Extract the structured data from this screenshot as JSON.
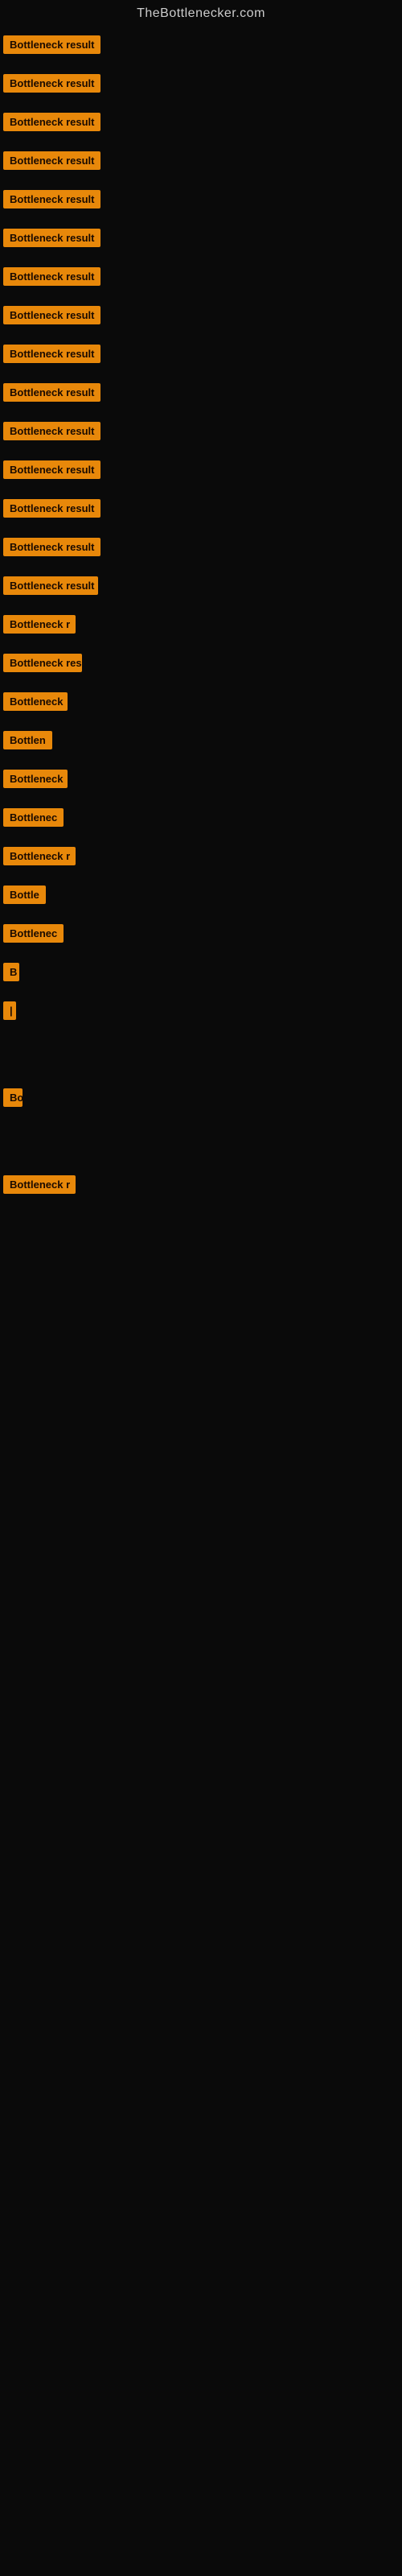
{
  "site": {
    "title": "TheBottlenecker.com"
  },
  "items": [
    {
      "label": "Bottleneck result",
      "width": 130
    },
    {
      "label": "Bottleneck result",
      "width": 135
    },
    {
      "label": "Bottleneck result",
      "width": 130
    },
    {
      "label": "Bottleneck result",
      "width": 130
    },
    {
      "label": "Bottleneck result",
      "width": 133
    },
    {
      "label": "Bottleneck result",
      "width": 128
    },
    {
      "label": "Bottleneck result",
      "width": 132
    },
    {
      "label": "Bottleneck result",
      "width": 130
    },
    {
      "label": "Bottleneck result",
      "width": 130
    },
    {
      "label": "Bottleneck result",
      "width": 128
    },
    {
      "label": "Bottleneck result",
      "width": 130
    },
    {
      "label": "Bottleneck result",
      "width": 130
    },
    {
      "label": "Bottleneck result",
      "width": 128
    },
    {
      "label": "Bottleneck result",
      "width": 130
    },
    {
      "label": "Bottleneck result",
      "width": 118
    },
    {
      "label": "Bottleneck r",
      "width": 90
    },
    {
      "label": "Bottleneck res",
      "width": 98
    },
    {
      "label": "Bottleneck",
      "width": 80
    },
    {
      "label": "Bottlen",
      "width": 65
    },
    {
      "label": "Bottleneck",
      "width": 80
    },
    {
      "label": "Bottlenec",
      "width": 75
    },
    {
      "label": "Bottleneck r",
      "width": 90
    },
    {
      "label": "Bottle",
      "width": 55
    },
    {
      "label": "Bottlenec",
      "width": 75
    },
    {
      "label": "B",
      "width": 20
    },
    {
      "label": "|",
      "width": 8
    },
    {
      "label": "",
      "width": 0
    },
    {
      "label": "",
      "width": 0
    },
    {
      "label": "",
      "width": 0
    },
    {
      "label": "Bo",
      "width": 24
    },
    {
      "label": "",
      "width": 0
    },
    {
      "label": "",
      "width": 0
    },
    {
      "label": "",
      "width": 0
    },
    {
      "label": "Bottleneck r",
      "width": 90
    },
    {
      "label": "",
      "width": 0
    },
    {
      "label": "",
      "width": 0
    },
    {
      "label": "",
      "width": 0
    }
  ]
}
